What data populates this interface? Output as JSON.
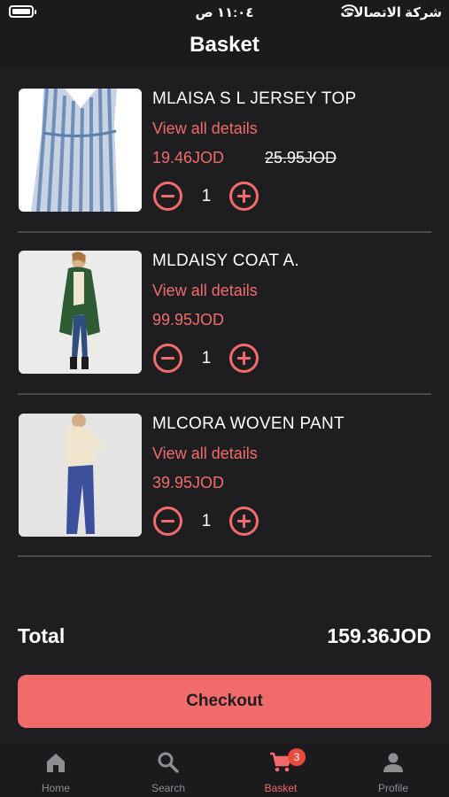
{
  "status_bar": {
    "time": "١١:٠٤ ص",
    "carrier": "شركة الاتصالات"
  },
  "header": {
    "title": "Basket"
  },
  "items": [
    {
      "name": "MLAISA S L JERSEY TOP",
      "details_link": "View all details",
      "price": "19.46JOD",
      "old_price": "25.95JOD",
      "quantity": "1"
    },
    {
      "name": "MLDAISY COAT A.",
      "details_link": "View all details",
      "price": "99.95JOD",
      "quantity": "1"
    },
    {
      "name": "MLCORA WOVEN PANT",
      "details_link": "View all details",
      "price": "39.95JOD",
      "quantity": "1"
    }
  ],
  "summary": {
    "total_label": "Total",
    "total_value": "159.36JOD",
    "checkout_label": "Checkout"
  },
  "tabbar": {
    "tabs": [
      {
        "label": "Home",
        "icon": "home-icon"
      },
      {
        "label": "Search",
        "icon": "search-icon"
      },
      {
        "label": "Basket",
        "icon": "cart-icon",
        "badge": "3"
      },
      {
        "label": "Profile",
        "icon": "person-icon"
      }
    ],
    "active": "Basket"
  },
  "colors": {
    "background": "#1e1e21",
    "accent": "#f26b6b",
    "divider": "#4a4a4e",
    "inactive_tab": "#8e8e93",
    "badge": "#e84b3c"
  }
}
